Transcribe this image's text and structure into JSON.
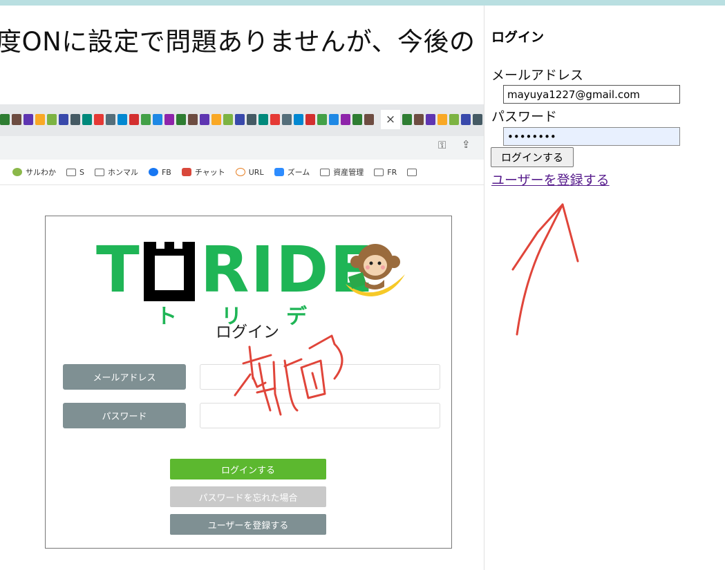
{
  "heading": "度ONに設定で問題ありませんが、今後の",
  "browser": {
    "tab_close": "×",
    "bookmarks": [
      {
        "label": "サルわか",
        "icon": "monkey-icon"
      },
      {
        "label": "S",
        "icon": "folder-icon"
      },
      {
        "label": "ホンマル",
        "icon": "folder-icon"
      },
      {
        "label": "FB",
        "icon": "facebook-icon"
      },
      {
        "label": "チャット",
        "icon": "chat-icon"
      },
      {
        "label": "URL",
        "icon": "link-icon"
      },
      {
        "label": "ズーム",
        "icon": "zoom-icon"
      },
      {
        "label": "資産管理",
        "icon": "folder-icon"
      },
      {
        "label": "FR",
        "icon": "folder-icon"
      }
    ]
  },
  "card": {
    "logo": "TORIDE",
    "logo_kana": "トリデ",
    "title": "ログイン",
    "email_label": "メールアドレス",
    "password_label": "パスワード",
    "login_button": "ログインする",
    "forgot_button": "パスワードを忘れた場合",
    "register_button": "ユーザーを登録する",
    "annotation": "動画"
  },
  "right": {
    "title": "ログイン",
    "email_label": "メールアドレス",
    "email_value": "mayuya1227@gmail.com",
    "password_label": "パスワード",
    "password_value": "••••••••",
    "login_button": "ログインする",
    "register_link": "ユーザーを登録する"
  },
  "colors": {
    "brand_green": "#1fb556",
    "login_green": "#5cb82f",
    "label_gray": "#7f9093",
    "annotation_red": "#e0453a",
    "link_purple": "#551a8b"
  }
}
